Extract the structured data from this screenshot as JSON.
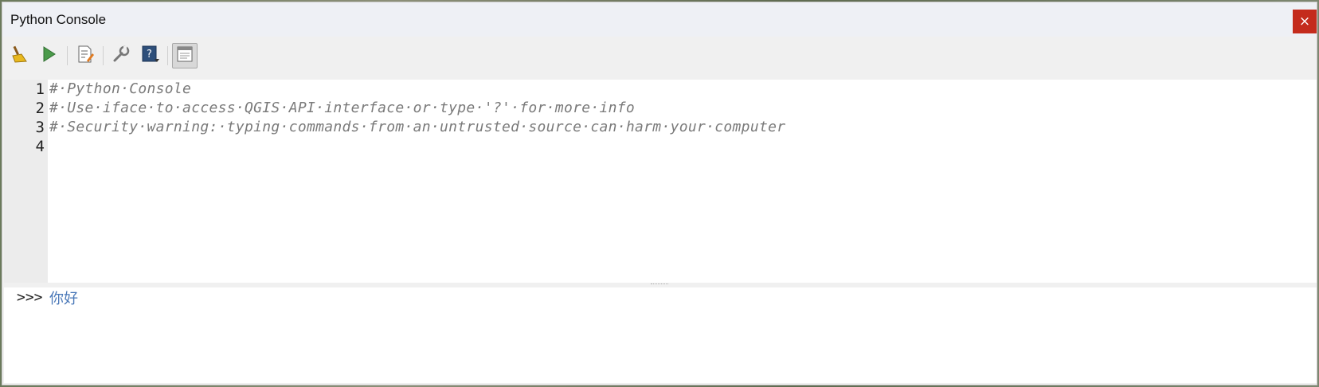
{
  "window": {
    "title": "Python Console",
    "close_label": "×"
  },
  "toolbar": {
    "buttons": [
      {
        "name": "clear-console-button",
        "icon": "broom-icon"
      },
      {
        "name": "run-command-button",
        "icon": "play-icon"
      },
      {
        "name": "show-editor-button",
        "icon": "script-edit-icon"
      },
      {
        "name": "settings-button",
        "icon": "wrench-icon"
      },
      {
        "name": "help-button",
        "icon": "help-book-icon"
      },
      {
        "name": "dock-undock-button",
        "icon": "window-icon"
      }
    ]
  },
  "editor": {
    "line_numbers": [
      "1",
      "2",
      "3",
      "4"
    ],
    "lines": [
      "#·Python·Console",
      "#·Use·iface·to·access·QGIS·API·interface·or·type·'?'·for·more·info",
      "#·Security·warning:·typing·commands·from·an·untrusted·source·can·harm·your·computer",
      ""
    ]
  },
  "shell": {
    "prompt": ">>>",
    "input_value": "你好"
  },
  "colors": {
    "close": "#c42b1c",
    "comment": "#7a7a7a",
    "input_text": "#4a78b8"
  }
}
